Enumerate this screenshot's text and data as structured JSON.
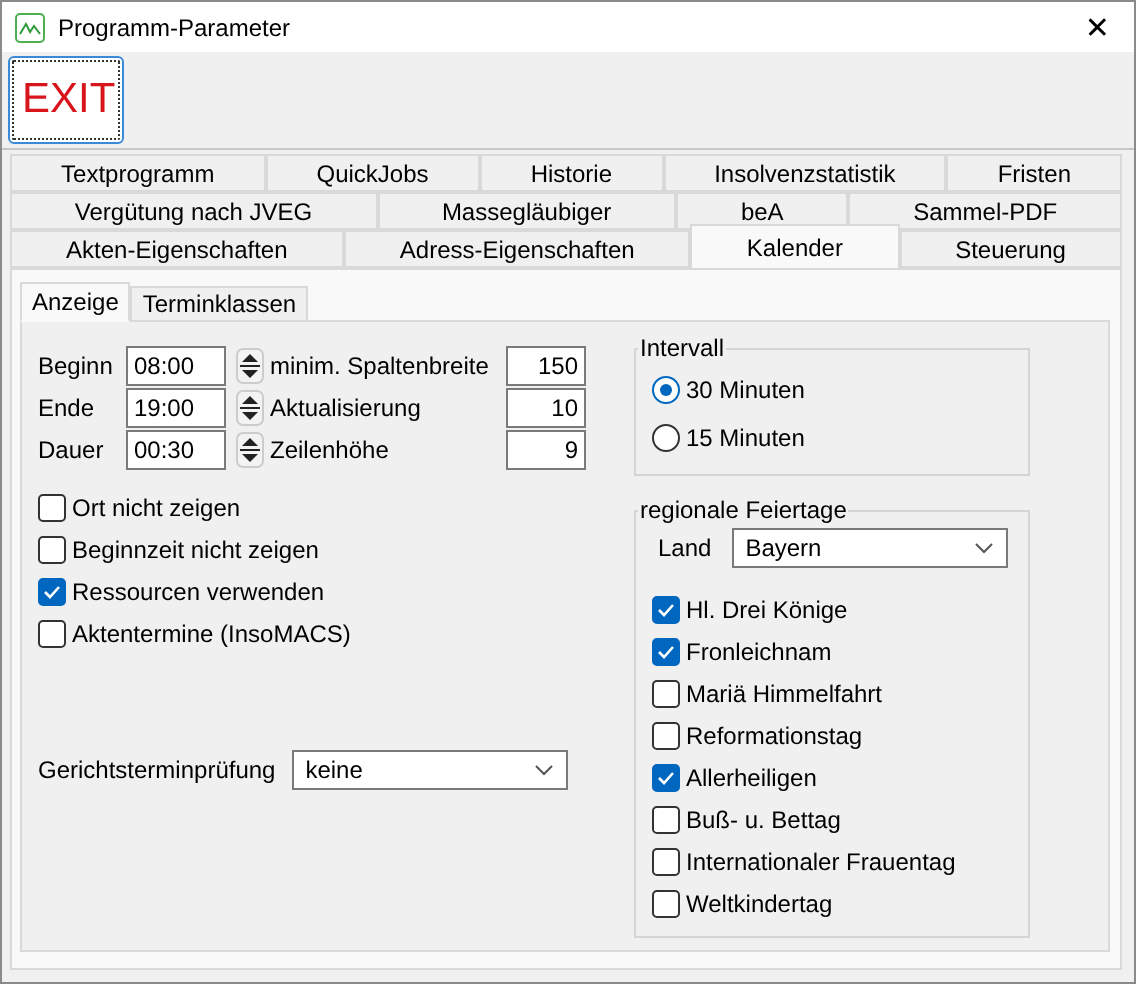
{
  "window": {
    "title": "Programm-Parameter",
    "close": "✕"
  },
  "toolbar": {
    "exit_button": "EXIT"
  },
  "tab_rows": [
    [
      {
        "label": "Textprogramm",
        "selected": false
      },
      {
        "label": "QuickJobs",
        "selected": false
      },
      {
        "label": "Historie",
        "selected": false
      },
      {
        "label": "Insolvenzstatistik",
        "selected": false
      },
      {
        "label": "Fristen",
        "selected": false
      }
    ],
    [
      {
        "label": "Vergütung nach JVEG",
        "selected": false
      },
      {
        "label": "Massegläubiger",
        "selected": false
      },
      {
        "label": "beA",
        "selected": false
      },
      {
        "label": "Sammel-PDF",
        "selected": false
      }
    ],
    [
      {
        "label": "Akten-Eigenschaften",
        "selected": false
      },
      {
        "label": "Adress-Eigenschaften",
        "selected": false
      },
      {
        "label": "Kalender",
        "selected": true
      },
      {
        "label": "Steuerung",
        "selected": false
      }
    ]
  ],
  "sub_tabs": [
    {
      "label": "Anzeige",
      "selected": true
    },
    {
      "label": "Terminklassen",
      "selected": false
    }
  ],
  "time_fields": [
    {
      "label": "Beginn",
      "value": "08:00"
    },
    {
      "label": "Ende",
      "value": "19:00"
    },
    {
      "label": "Dauer",
      "value": "00:30"
    }
  ],
  "number_fields": [
    {
      "label": "minim. Spaltenbreite",
      "value": "150"
    },
    {
      "label": "Aktualisierung",
      "value": "10"
    },
    {
      "label": "Zeilenhöhe",
      "value": "9"
    }
  ],
  "options": [
    {
      "label": "Ort nicht zeigen",
      "checked": false
    },
    {
      "label": "Beginnzeit nicht zeigen",
      "checked": false
    },
    {
      "label": "Ressourcen verwenden",
      "checked": true
    },
    {
      "label": "Aktentermine (InsoMACS)",
      "checked": false
    }
  ],
  "court_check": {
    "label": "Gerichtsterminprüfung",
    "value": "keine"
  },
  "interval": {
    "title": "Intervall",
    "options": [
      {
        "label": "30 Minuten",
        "selected": true
      },
      {
        "label": "15 Minuten",
        "selected": false
      }
    ]
  },
  "holidays": {
    "title": "regionale Feiertage",
    "land_label": "Land",
    "land_value": "Bayern",
    "items": [
      {
        "label": "Hl. Drei Könige",
        "checked": true
      },
      {
        "label": "Fronleichnam",
        "checked": true
      },
      {
        "label": "Mariä Himmelfahrt",
        "checked": false
      },
      {
        "label": "Reformationstag",
        "checked": false
      },
      {
        "label": "Allerheiligen",
        "checked": true
      },
      {
        "label": "Buß- u. Bettag",
        "checked": false
      },
      {
        "label": "Internationaler Frauentag",
        "checked": false
      },
      {
        "label": "Weltkindertag",
        "checked": false
      }
    ]
  }
}
